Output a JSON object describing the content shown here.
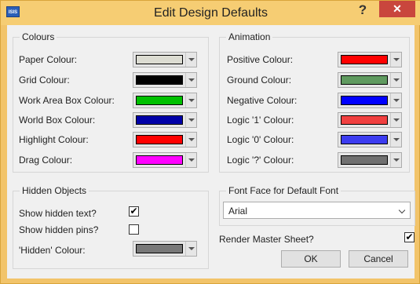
{
  "window": {
    "title": "Edit Design Defaults",
    "app_icon_text": "ISIS",
    "help_glyph": "?",
    "close_glyph": "✕"
  },
  "colours": {
    "title": "Colours",
    "items": [
      {
        "label": "Paper Colour:",
        "color": "#dcdcd2"
      },
      {
        "label": "Grid Colour:",
        "color": "#000000"
      },
      {
        "label": "Work Area Box Colour:",
        "color": "#00c000"
      },
      {
        "label": "World Box Colour:",
        "color": "#0000a8"
      },
      {
        "label": "Highlight Colour:",
        "color": "#ff0000"
      },
      {
        "label": "Drag Colour:",
        "color": "#ff00ff"
      }
    ]
  },
  "animation": {
    "title": "Animation",
    "items": [
      {
        "label": "Positive Colour:",
        "color": "#ff0000"
      },
      {
        "label": "Ground Colour:",
        "color": "#5f9a5f"
      },
      {
        "label": "Negative Colour:",
        "color": "#0000ff"
      },
      {
        "label": "Logic '1' Colour:",
        "color": "#f04040"
      },
      {
        "label": "Logic '0' Colour:",
        "color": "#3c3cf0"
      },
      {
        "label": "Logic '?' Colour:",
        "color": "#707070"
      }
    ]
  },
  "hidden_objects": {
    "title": "Hidden Objects",
    "show_hidden_text": {
      "label": "Show hidden text?",
      "checked": true,
      "glyph": "✔"
    },
    "show_hidden_pins": {
      "label": "Show hidden pins?",
      "checked": false,
      "glyph": ""
    },
    "hidden_colour": {
      "label": "'Hidden' Colour:",
      "color": "#787878"
    }
  },
  "font_face": {
    "title": "Font Face for Default Font",
    "value": "Arial"
  },
  "render_master": {
    "label": "Render Master Sheet?",
    "checked": true,
    "glyph": "✔"
  },
  "buttons": {
    "ok": "OK",
    "cancel": "Cancel"
  }
}
